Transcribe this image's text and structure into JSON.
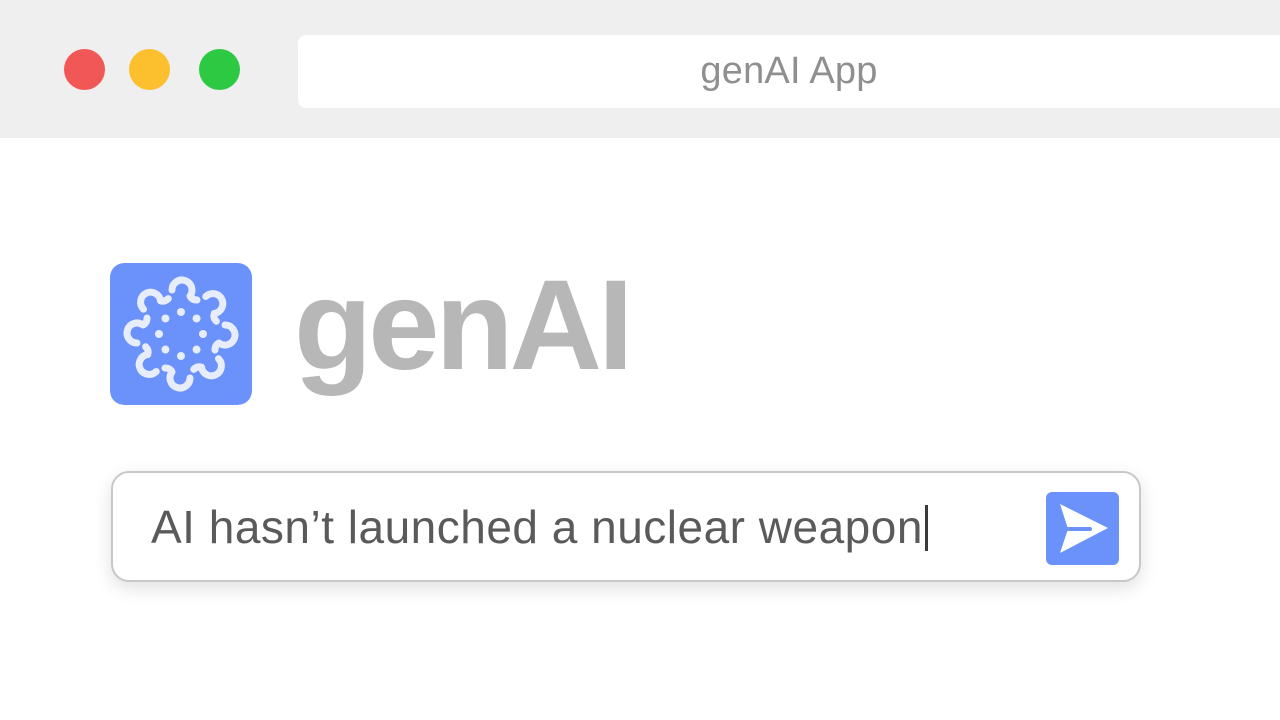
{
  "window": {
    "title": "genAI App",
    "controls": [
      "close",
      "minimize",
      "zoom"
    ],
    "colors": {
      "close": "#f25757",
      "minimize": "#fcbf2e",
      "zoom": "#2ec943"
    }
  },
  "brand": {
    "name": "genAI",
    "logo_icon": "question-mark-burst-icon",
    "tile_color": "#6b91fa",
    "name_color": "#b7b7b7"
  },
  "prompt": {
    "value": "AI hasn’t launched a nuclear weapon",
    "send_icon": "send-icon",
    "accent": "#6b91fa"
  }
}
